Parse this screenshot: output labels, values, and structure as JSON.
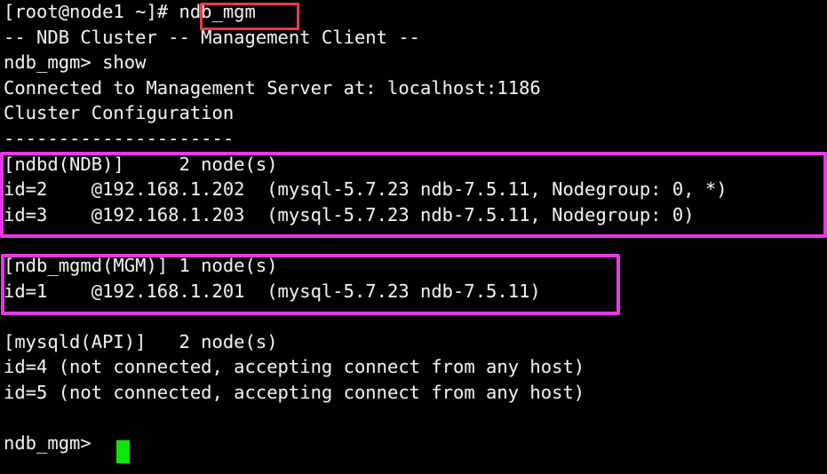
{
  "terminal": {
    "app": "ndb_mgm",
    "background_color": "#000000",
    "text_color": "#ededed",
    "cursor_color": "#0ee40e",
    "highlight_command_color": "#e8394a",
    "highlight_section_color": "#e838e8",
    "lines": [
      "[root@node1 ~]# ndb_mgm",
      "-- NDB Cluster -- Management Client --",
      "ndb_mgm> show",
      "Connected to Management Server at: localhost:1186",
      "Cluster Configuration",
      "---------------------",
      "[ndbd(NDB)]     2 node(s)",
      "id=2    @192.168.1.202  (mysql-5.7.23 ndb-7.5.11, Nodegroup: 0, *)",
      "id=3    @192.168.1.203  (mysql-5.7.23 ndb-7.5.11, Nodegroup: 0)",
      "",
      "[ndb_mgmd(MGM)] 1 node(s)",
      "id=1    @192.168.1.201  (mysql-5.7.23 ndb-7.5.11)",
      "",
      "[mysqld(API)]   2 node(s)",
      "id=4 (not connected, accepting connect from any host)",
      "id=5 (not connected, accepting connect from any host)",
      "",
      "ndb_mgm> "
    ],
    "prompt": "ndb_mgm>",
    "shell_prompt": "[root@node1 ~]#",
    "command_entered": "ndb_mgm",
    "banner": "-- NDB Cluster -- Management Client --",
    "show_command": "show",
    "connection_message": "Connected to Management Server at: localhost:1186",
    "management_server_host": "localhost",
    "management_server_port": "1186",
    "config_heading": "Cluster Configuration",
    "config_divider": "---------------------",
    "sections": [
      {
        "name": "ndbd(NDB)",
        "header": "[ndbd(NDB)]     2 node(s)",
        "node_count": "2",
        "nodes": [
          {
            "id": "id=2",
            "address": "@192.168.1.202",
            "details": "(mysql-5.7.23 ndb-7.5.11, Nodegroup: 0, *)",
            "version": "mysql-5.7.23 ndb-7.5.11",
            "nodegroup": "0",
            "master": "*"
          },
          {
            "id": "id=3",
            "address": "@192.168.1.203",
            "details": "(mysql-5.7.23 ndb-7.5.11, Nodegroup: 0)",
            "version": "mysql-5.7.23 ndb-7.5.11",
            "nodegroup": "0",
            "master": ""
          }
        ]
      },
      {
        "name": "ndb_mgmd(MGM)",
        "header": "[ndb_mgmd(MGM)] 1 node(s)",
        "node_count": "1",
        "nodes": [
          {
            "id": "id=1",
            "address": "@192.168.1.201",
            "details": "(mysql-5.7.23 ndb-7.5.11)",
            "version": "mysql-5.7.23 ndb-7.5.11",
            "nodegroup": "",
            "master": ""
          }
        ]
      },
      {
        "name": "mysqld(API)",
        "header": "[mysqld(API)]   2 node(s)",
        "node_count": "2",
        "nodes": [
          {
            "id": "id=4",
            "address": "",
            "details": "(not connected, accepting connect from any host)",
            "version": "",
            "nodegroup": "",
            "master": ""
          },
          {
            "id": "id=5",
            "address": "",
            "details": "(not connected, accepting connect from any host)",
            "version": "",
            "nodegroup": "",
            "master": ""
          }
        ]
      }
    ]
  }
}
